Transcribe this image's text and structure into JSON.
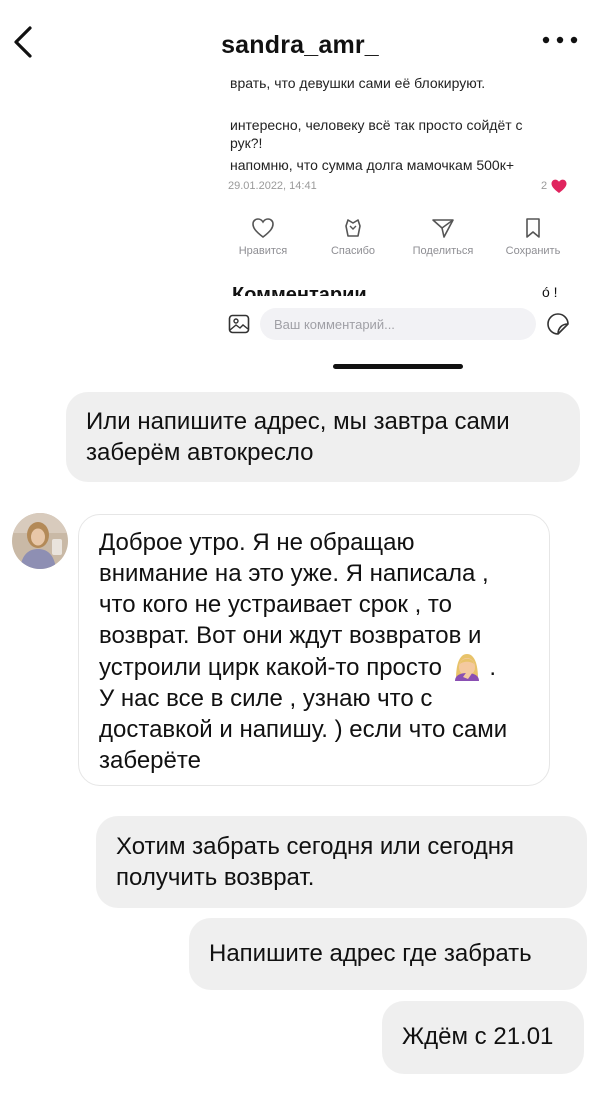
{
  "header": {
    "back_icon": "chevron-left-icon",
    "title": "sandra_amr_",
    "more_icon": "more-horizontal-icon"
  },
  "embedded_post": {
    "lines": [
      "врать, что девушки сами её блокируют.",
      "интересно, человеку всё так просто сойдёт с",
      "рук?!",
      "напомню, что сумма долга мамочкам 500к+"
    ],
    "date": "29.01.2022, 14:41",
    "likes": "2",
    "actions": [
      {
        "label": "Нравится",
        "icon": "heart-outline-icon"
      },
      {
        "label": "Спасибо",
        "icon": "gift-icon"
      },
      {
        "label": "Поделиться",
        "icon": "send-icon"
      },
      {
        "label": "Сохранить",
        "icon": "bookmark-icon"
      }
    ],
    "comments_title": "Комментарии",
    "comments_count": "ó !",
    "comment_placeholder": "Ваш комментарий...",
    "accent_color": "#e0245e"
  },
  "messages": [
    {
      "side": "out",
      "lines": [
        "Или напишите адрес, мы завтра сами",
        "заберём автокресло"
      ]
    },
    {
      "side": "in",
      "lines": [
        "Доброе утро. Я не обращаю",
        "внимание на это уже. Я написала ,",
        "что кого не устраивает срок , то",
        "возврат. Вот они ждут возвратов и",
        "устроили цирк какой-то просто",
        ".",
        "У нас все в силе , узнаю что с",
        "доставкой и напишу. ) если что сами",
        "заберёте"
      ],
      "emoji": "face-palm-emoji"
    },
    {
      "side": "out",
      "lines": [
        "Хотим забрать сегодня или сегодня",
        "получить возврат."
      ]
    },
    {
      "side": "out",
      "lines": [
        "Напишите адрес где забрать"
      ]
    },
    {
      "side": "out",
      "lines": [
        "Ждём с 21.01"
      ]
    }
  ],
  "colors": {
    "bubble_out": "#efefef",
    "bubble_in_border": "#e6e6e6"
  }
}
